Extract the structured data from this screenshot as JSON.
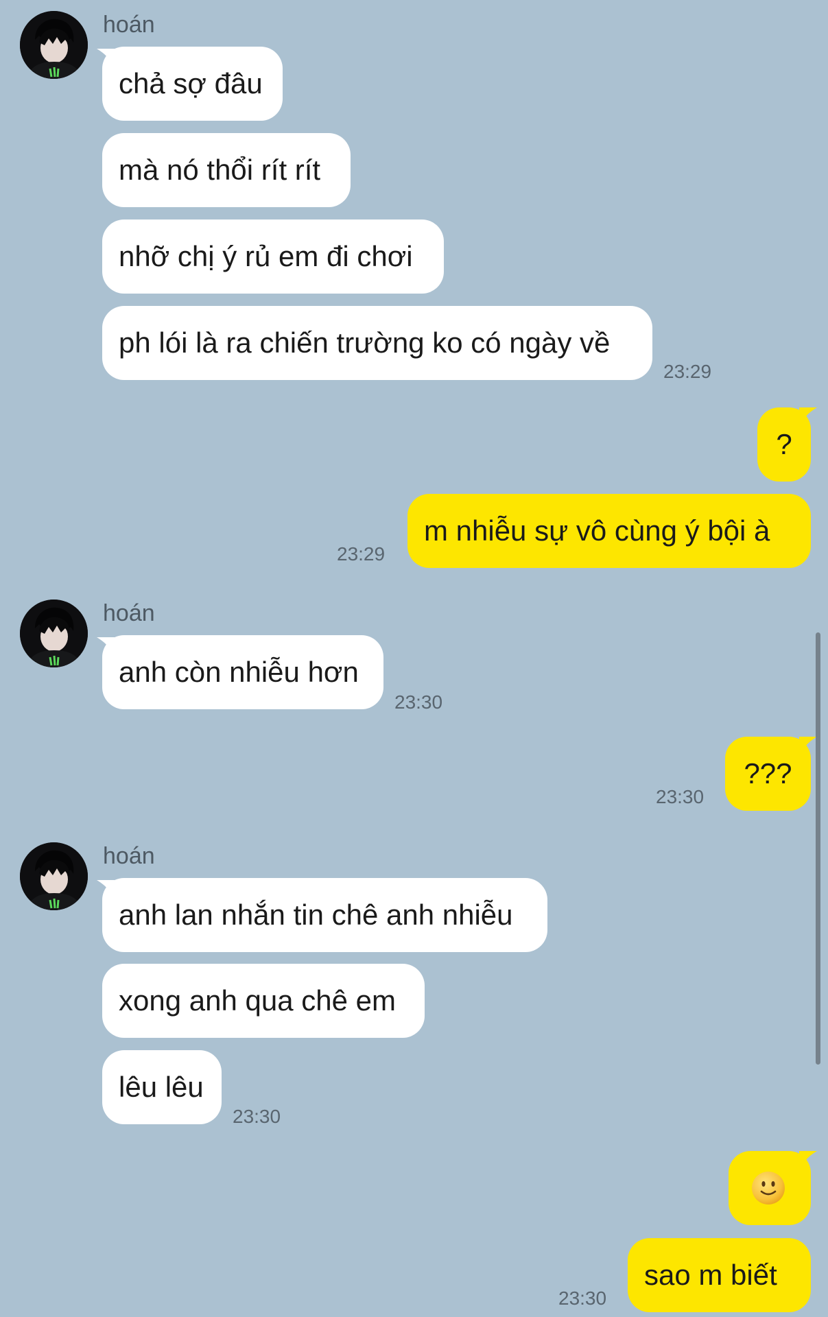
{
  "contact": {
    "name": "hoán"
  },
  "messages": [
    {
      "id": "m1",
      "from": "contact",
      "text": "chả sợ đâu"
    },
    {
      "id": "m2",
      "from": "contact",
      "text": "mà nó thổi rít rít"
    },
    {
      "id": "m3",
      "from": "contact",
      "text": "nhỡ chị ý rủ em đi chơi"
    },
    {
      "id": "m4",
      "from": "contact",
      "text": "ph lói là ra chiến trường ko có ngày về",
      "time": "23:29"
    },
    {
      "id": "m5",
      "from": "me",
      "text": "?"
    },
    {
      "id": "m6",
      "from": "me",
      "text": "m nhiễu sự vô cùng ý bội à",
      "time": "23:29"
    },
    {
      "id": "m7",
      "from": "contact",
      "text": "anh còn nhiễu hơn",
      "time": "23:30"
    },
    {
      "id": "m8",
      "from": "me",
      "text": "???",
      "time": "23:30"
    },
    {
      "id": "m9",
      "from": "contact",
      "text": "anh lan nhắn tin chê anh nhiễu"
    },
    {
      "id": "m10",
      "from": "contact",
      "text": "xong anh qua chê em"
    },
    {
      "id": "m11",
      "from": "contact",
      "text": "lêu lêu",
      "time": "23:30"
    },
    {
      "id": "m12",
      "from": "me",
      "text": "",
      "emoji": "slightly-smiling-face"
    },
    {
      "id": "m13",
      "from": "me",
      "text": "sao m biết",
      "time": "23:30"
    }
  ],
  "colors": {
    "background": "#abc1d1",
    "incoming_bubble": "#ffffff",
    "outgoing_bubble": "#fde600",
    "timestamp": "#59656f"
  }
}
